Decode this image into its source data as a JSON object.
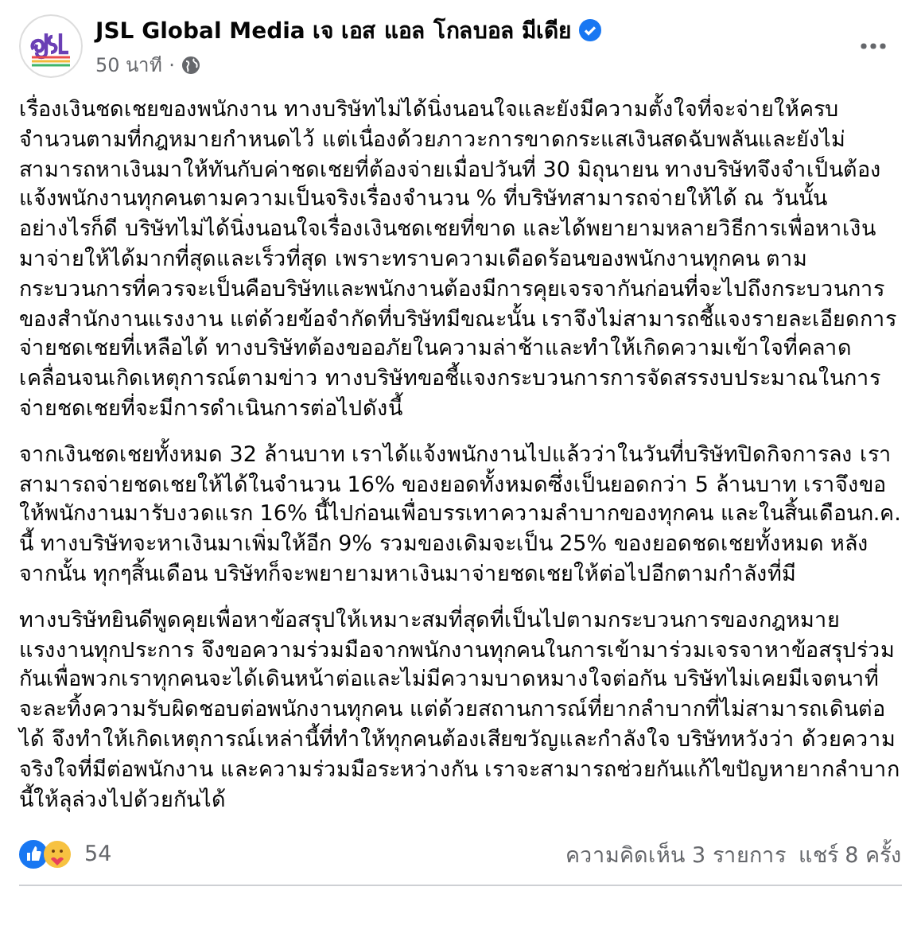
{
  "post": {
    "author": "JSL Global Media เจ เอส แอล โกลบอล มีเดีย",
    "verified": true,
    "time": "50 นาที",
    "separator": "·",
    "paragraphs": [
      "เรื่องเงินชดเชยของพนักงาน ทางบริษัทไม่ได้นิ่งนอนใจและยังมีความตั้งใจที่จะจ่ายให้ครบจำนวนตามที่กฎหมายกำหนดไว้ แต่เนื่องด้วยภาวะการขาดกระแสเงินสดฉับพลันและยังไม่สามารถหาเงินมาให้ทันกับค่าชดเชยที่ต้องจ่ายเมื่อปวันที่ 30 มิถุนายน ทางบริษัทจึงจำเป็นต้องแจ้งพนักงานทุกคนตามความเป็นจริงเรื่องจำนวน % ที่บริษัทสามารถจ่ายให้ได้ ณ วันนั้น อย่างไรก็ดี บริษัทไม่ได้นิ่งนอนใจเรื่องเงินชดเชยที่ขาด และได้พยายามหลายวิธีการเพื่อหาเงินมาจ่ายให้ได้มากที่สุดและเร็วที่สุด เพราะทราบความเดือดร้อนของพนักงานทุกคน ตามกระบวนการที่ควรจะเป็นคือบริษัทและพนักงานต้องมีการคุยเจรจากันก่อนที่จะไปถึงกระบวนการของสำนักงานแรงงาน แต่ด้วยข้อจำกัดที่บริษัทมีขณะนั้น เราจึงไม่สามารถชี้แจงรายละเอียดการจ่ายชดเชยที่เหลือได้ ทางบริษัทต้องขออภัยในความล่าช้าและทำให้เกิดความเข้าใจที่คลาดเคลื่อนจนเกิดเหตุการณ์ตามข่าว ทางบริษัทขอชี้แจงกระบวนการการจัดสรรงบประมาณในการจ่ายชดเชยที่จะมีการดำเนินการต่อไปดังนี้",
      "จากเงินชดเชยทั้งหมด 32 ล้านบาท เราได้แจ้งพนักงานไปแล้วว่าในวันที่บริษัทปิดกิจการลง เราสามารถจ่ายชดเชยให้ได้ในจำนวน 16% ของยอดทั้งหมดซึ่งเป็นยอดกว่า 5 ล้านบาท เราจึงขอให้พนักงานมารับงวดแรก 16% นี้ไปก่อนเพื่อบรรเทาความลำบากของทุกคน และในสิ้นเดือนก.ค. นี้ ทางบริษัทจะหาเงินมาเพิ่มให้อีก 9% รวมของเดิมจะเป็น 25% ของยอดชดเชยทั้งหมด หลังจากนั้น ทุกๆสิ้นเดือน บริษัทก็จะพยายามหาเงินมาจ่ายชดเชยให้ต่อไปอีกตามกำลังที่มี",
      "ทางบริษัทยินดีพูดคุยเพื่อหาข้อสรุปให้เหมาะสมที่สุดที่เป็นไปตามกระบวนการของกฎหมายแรงงานทุกประการ จึงขอความร่วมมือจากพนักงานทุกคนในการเข้ามาร่วมเจรจาหาข้อสรุปร่วมกันเพื่อพวกเราทุกคนจะได้เดินหน้าต่อและไม่มีความบาดหมางใจต่อกัน บริษัทไม่เคยมีเจตนาที่จะละทิ้งความรับผิดชอบต่อพนักงานทุกคน แต่ด้วยสถานการณ์ที่ยากลำบากที่ไม่สามารถเดินต่อได้ จึงทำให้เกิดเหตุการณ์เหล่านี้ที่ทำให้ทุกคนต้องเสียขวัญและกำลังใจ บริษัทหวังว่า ด้วยความจริงใจที่มีต่อพนักงาน และความร่วมมือระหว่างกัน เราจะสามารถช่วยกันแก้ไขปัญหายากลำบากนี้ให้ลุล่วงไปด้วยกันได้"
    ],
    "reaction_count": "54",
    "comments": "ความคิดเห็น 3 รายการ",
    "shares": "แชร์ 8 ครั้ง"
  }
}
